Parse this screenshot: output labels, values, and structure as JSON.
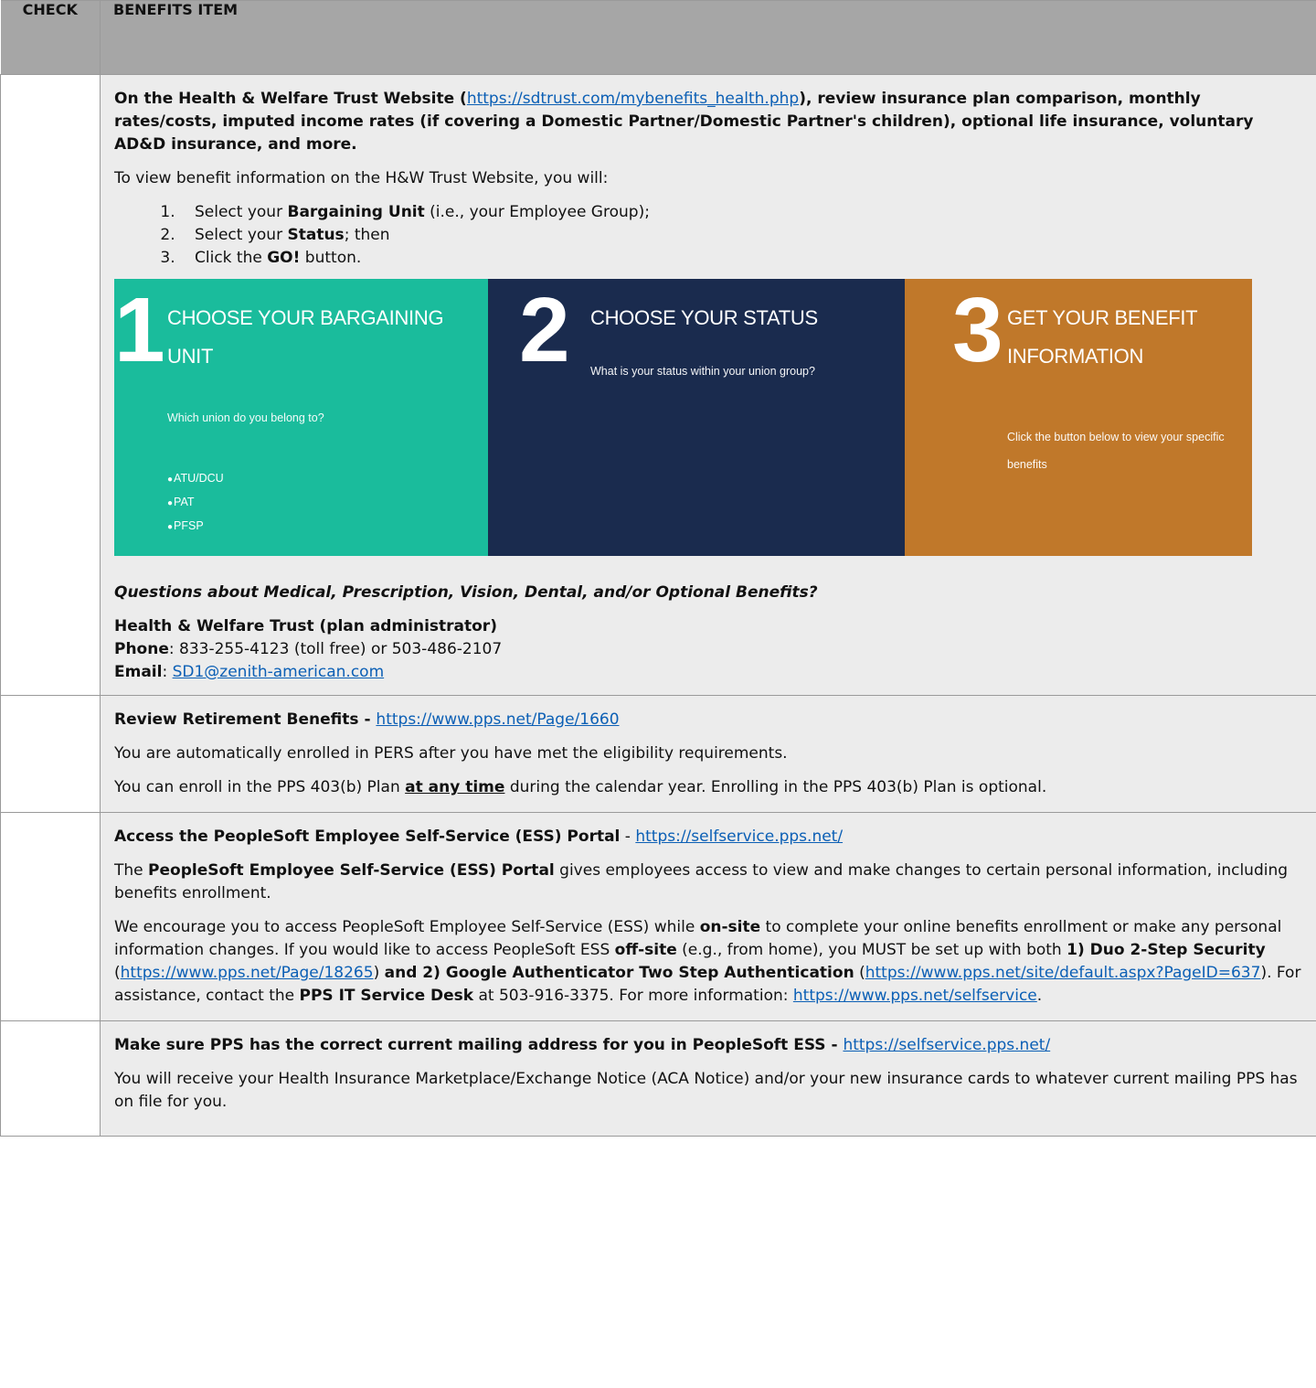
{
  "header": {
    "check": "CHECK",
    "item": "BENEFITS ITEM"
  },
  "row1": {
    "intro_a": "On the Health & Welfare Trust Website (",
    "intro_link": "https://sdtrust.com/mybenefits_health.php",
    "intro_b": "), review insurance plan comparison, monthly rates/costs, imputed income rates (if covering a Domestic Partner/Domestic Partner's children), optional life insurance, voluntary AD&D insurance, and more.",
    "view_text": "To view benefit information on the H&W Trust Website, you will:",
    "steps": [
      {
        "pre": "Select your ",
        "bold": "Bargaining Unit",
        "post": " (i.e., your Employee Group);"
      },
      {
        "pre": "Select your ",
        "bold": "Status",
        "post": "; then"
      },
      {
        "pre": "Click the ",
        "bold": "GO!",
        "post": " button."
      }
    ],
    "banner": {
      "p1": {
        "num": "1",
        "title_l1": "Choose your Bargaining",
        "title_l2": "Unit",
        "sub": "Which union do you belong to?",
        "units": [
          "ATU/DCU",
          "PAT",
          "PFSP"
        ]
      },
      "p2": {
        "num": "2",
        "title_l1": "Choose your Status",
        "sub": "What is your status within your union group?"
      },
      "p3": {
        "num": "3",
        "title_l1": "Get your benefit",
        "title_l2": "information",
        "sub": "Click the button below to view your specific benefits"
      },
      "colors": {
        "p1": "#1abc9c",
        "p2": "#1a2b4e",
        "p3": "#c0782a"
      }
    },
    "questions": "Questions about Medical, Prescription, Vision, Dental, and/or Optional Benefits?",
    "contact_org": "Health & Welfare Trust (plan administrator)",
    "phone_label": "Phone",
    "phone_value": ": 833-255-4123 (toll free) or 503-486-2107",
    "email_label": "Email",
    "email_value": "SD1@zenith-american.com"
  },
  "row2": {
    "title": "Review Retirement Benefits - ",
    "link": "https://www.pps.net/Page/1660",
    "p1": "You are automatically enrolled in PERS after you have met the eligibility requirements.",
    "p2_a": "You can enroll in the PPS 403(b) Plan ",
    "p2_u": "at any time",
    "p2_b": " during the calendar year.  Enrolling in the PPS 403(b) Plan is optional."
  },
  "row3": {
    "title": "Access the PeopleSoft Employee Self-Service (ESS) Portal",
    "dash": " - ",
    "link": "https://selfservice.pps.net/",
    "p1_a": "The ",
    "p1_b": "PeopleSoft Employee Self-Service (ESS) Portal",
    "p1_c": " gives employees access to view and make changes to certain personal information, including benefits enrollment.",
    "p2_a": "We encourage you to access PeopleSoft Employee Self-Service (ESS) while ",
    "p2_b": "on-site",
    "p2_c": " to complete your online benefits enrollment or make any personal information changes. If you would like to access PeopleSoft ESS ",
    "p2_d": "off-site",
    "p2_e": " (e.g., from home), you MUST be set up with both ",
    "p2_f": "1) Duo 2-Step Security",
    "p2_g": " (",
    "p2_link1": "https://www.pps.net/Page/18265",
    "p2_h": ") ",
    "p2_i": "and 2) Google Authenticator Two Step Authentication",
    "p2_j": " (",
    "p2_link2": "https://www.pps.net/site/default.aspx?PageID=637",
    "p2_k": ").  For assistance, contact the ",
    "p2_l": "PPS IT Service Desk",
    "p2_m": " at 503-916-3375. For more information: ",
    "p2_link3": "https://www.pps.net/selfservice",
    "p2_n": "."
  },
  "row4": {
    "title": "Make sure PPS has the correct current mailing address for you in PeopleSoft ESS - ",
    "link": "https://selfservice.pps.net/",
    "p1": "You will receive your Health Insurance Marketplace/Exchange Notice (ACA Notice) and/or your new insurance cards to whatever current mailing PPS has on file for you."
  }
}
